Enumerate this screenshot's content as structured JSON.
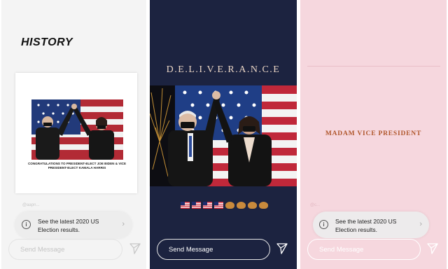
{
  "panel1": {
    "title": "HISTORY",
    "caption": "CONGRATULATIONS TO PRESIDENT-ELECT JOE BIDEN & VICE PRESIDENT-ELECT KAMALA HARRIS",
    "handle": "@aapn...",
    "election_text": "See the latest 2020 US Election results.",
    "message_placeholder": "Send Message"
  },
  "panel2": {
    "title": "D.E.L.I.V.E.R.A.N.C.E",
    "emoji_row": [
      "flag",
      "flag",
      "flag",
      "flag",
      "clap",
      "clap",
      "clap",
      "clap"
    ],
    "message_placeholder": "Send Message"
  },
  "panel3": {
    "title": "MADAM VICE PRESIDENT",
    "handle": "@c...",
    "election_text": "See the latest 2020 US Election results.",
    "message_placeholder": "Send Message"
  },
  "colors": {
    "navy": "#1c2340",
    "pink": "#f6d7de",
    "title_rust": "#b0572c",
    "flag_red": "#c22533",
    "flag_blue": "#1e2c6b"
  },
  "icons": [
    "info-icon",
    "chevron-right-icon",
    "send-icon"
  ]
}
